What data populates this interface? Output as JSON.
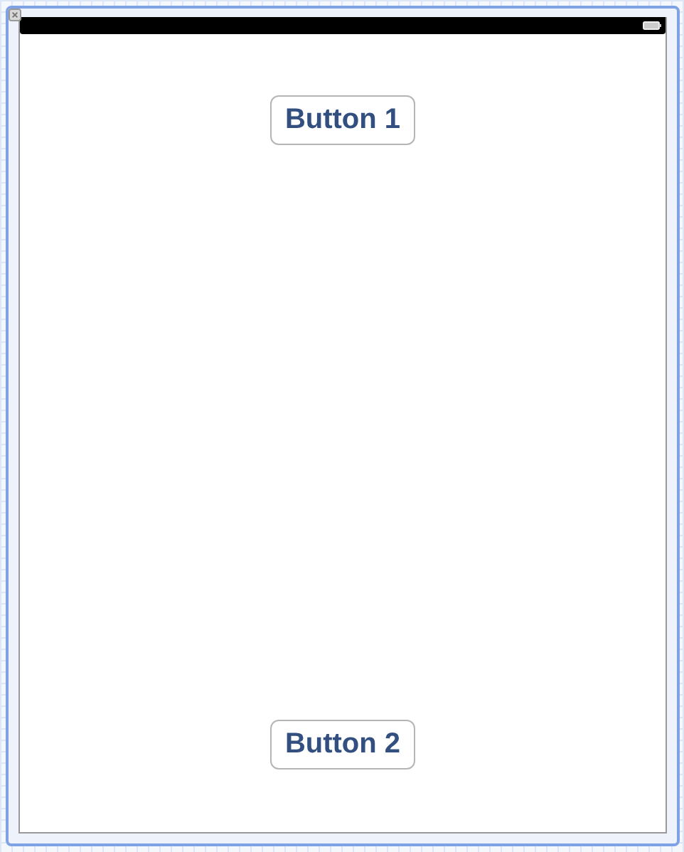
{
  "buttons": [
    {
      "label": "Button 1"
    },
    {
      "label": "Button 2"
    }
  ]
}
